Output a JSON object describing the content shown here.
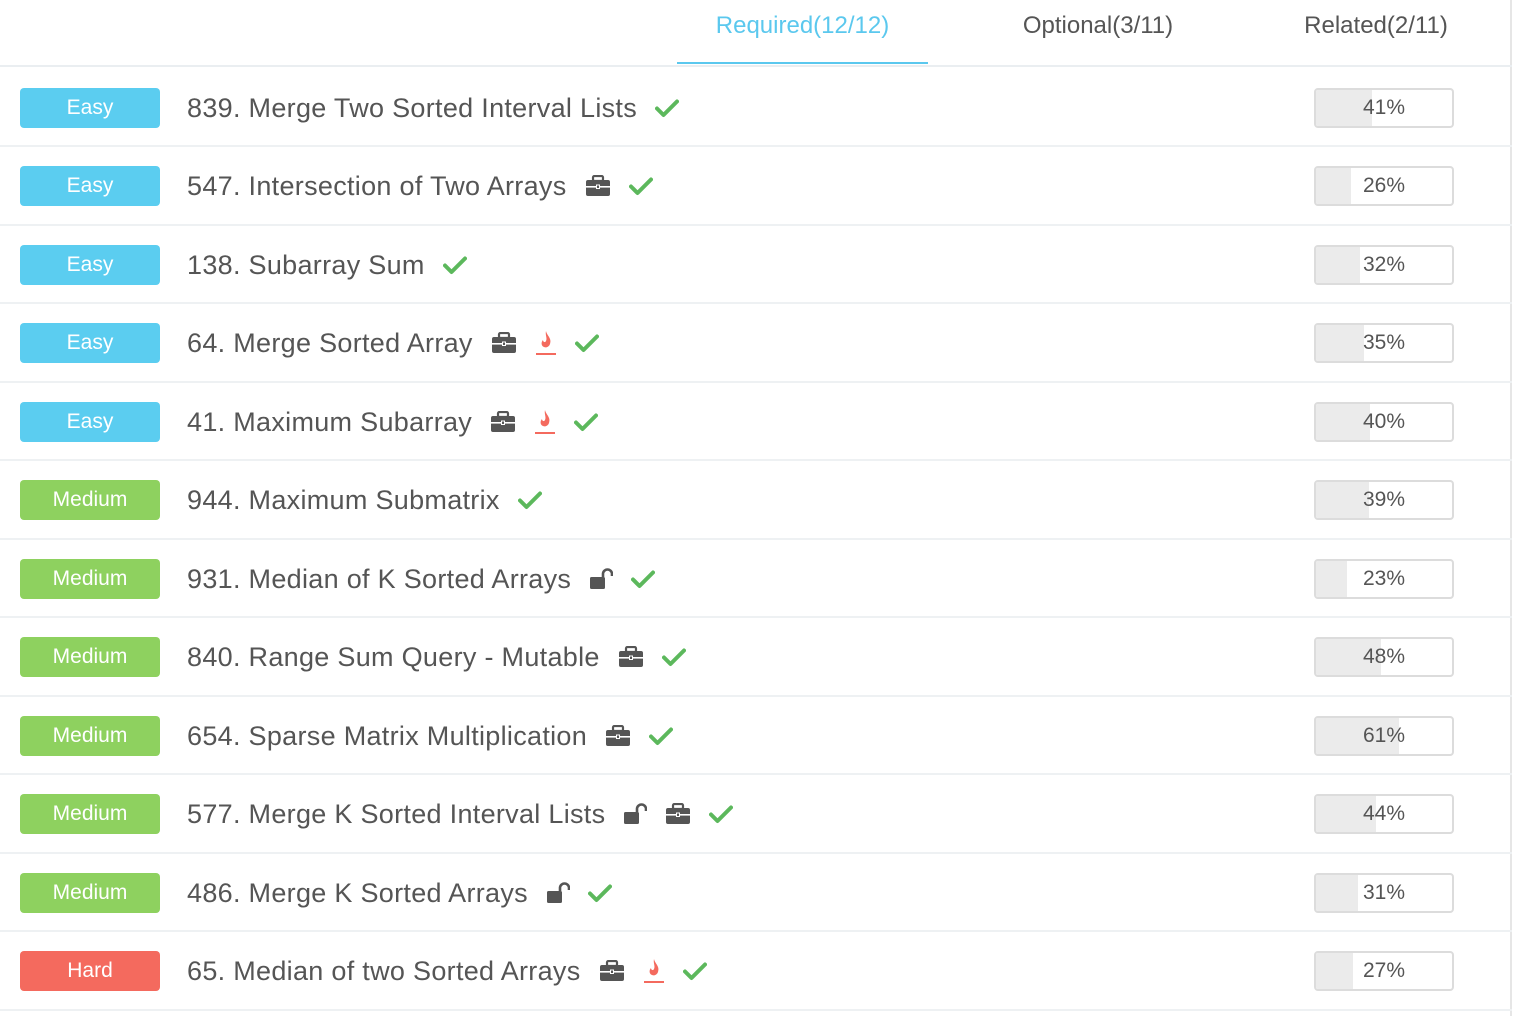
{
  "tabs": [
    {
      "label": "Required(12/12)",
      "active": true
    },
    {
      "label": "Optional(3/11)",
      "active": false
    },
    {
      "label": "Related(2/11)",
      "active": false
    }
  ],
  "colors": {
    "accent": "#5bc8ee",
    "easy": "#5bcdf0",
    "medium": "#8ed15f",
    "hard": "#f46a5e",
    "check": "#5cb85c",
    "fire": "#f46a5e",
    "icon": "#555555"
  },
  "problems": [
    {
      "difficulty": "Easy",
      "title": "839. Merge Two Sorted Interval Lists",
      "icons": [
        "check-icon"
      ],
      "rate": "41%",
      "rate_value": 0.41
    },
    {
      "difficulty": "Easy",
      "title": "547. Intersection of Two Arrays",
      "icons": [
        "briefcase-icon",
        "check-icon"
      ],
      "rate": "26%",
      "rate_value": 0.26
    },
    {
      "difficulty": "Easy",
      "title": "138. Subarray Sum",
      "icons": [
        "check-icon"
      ],
      "rate": "32%",
      "rate_value": 0.32
    },
    {
      "difficulty": "Easy",
      "title": "64. Merge Sorted Array",
      "icons": [
        "briefcase-icon",
        "fire-icon",
        "check-icon"
      ],
      "rate": "35%",
      "rate_value": 0.35
    },
    {
      "difficulty": "Easy",
      "title": "41. Maximum Subarray",
      "icons": [
        "briefcase-icon",
        "fire-icon",
        "check-icon"
      ],
      "rate": "40%",
      "rate_value": 0.4
    },
    {
      "difficulty": "Medium",
      "title": "944. Maximum Submatrix",
      "icons": [
        "check-icon"
      ],
      "rate": "39%",
      "rate_value": 0.39
    },
    {
      "difficulty": "Medium",
      "title": "931. Median of K Sorted Arrays",
      "icons": [
        "unlock-icon",
        "check-icon"
      ],
      "rate": "23%",
      "rate_value": 0.23
    },
    {
      "difficulty": "Medium",
      "title": "840. Range Sum Query - Mutable",
      "icons": [
        "briefcase-icon",
        "check-icon"
      ],
      "rate": "48%",
      "rate_value": 0.48
    },
    {
      "difficulty": "Medium",
      "title": "654. Sparse Matrix Multiplication",
      "icons": [
        "briefcase-icon",
        "check-icon"
      ],
      "rate": "61%",
      "rate_value": 0.61
    },
    {
      "difficulty": "Medium",
      "title": "577. Merge K Sorted Interval Lists",
      "icons": [
        "unlock-icon",
        "briefcase-icon",
        "check-icon"
      ],
      "rate": "44%",
      "rate_value": 0.44
    },
    {
      "difficulty": "Medium",
      "title": "486. Merge K Sorted Arrays",
      "icons": [
        "unlock-icon",
        "check-icon"
      ],
      "rate": "31%",
      "rate_value": 0.31
    },
    {
      "difficulty": "Hard",
      "title": "65. Median of two Sorted Arrays",
      "icons": [
        "briefcase-icon",
        "fire-icon",
        "check-icon"
      ],
      "rate": "27%",
      "rate_value": 0.27
    }
  ]
}
